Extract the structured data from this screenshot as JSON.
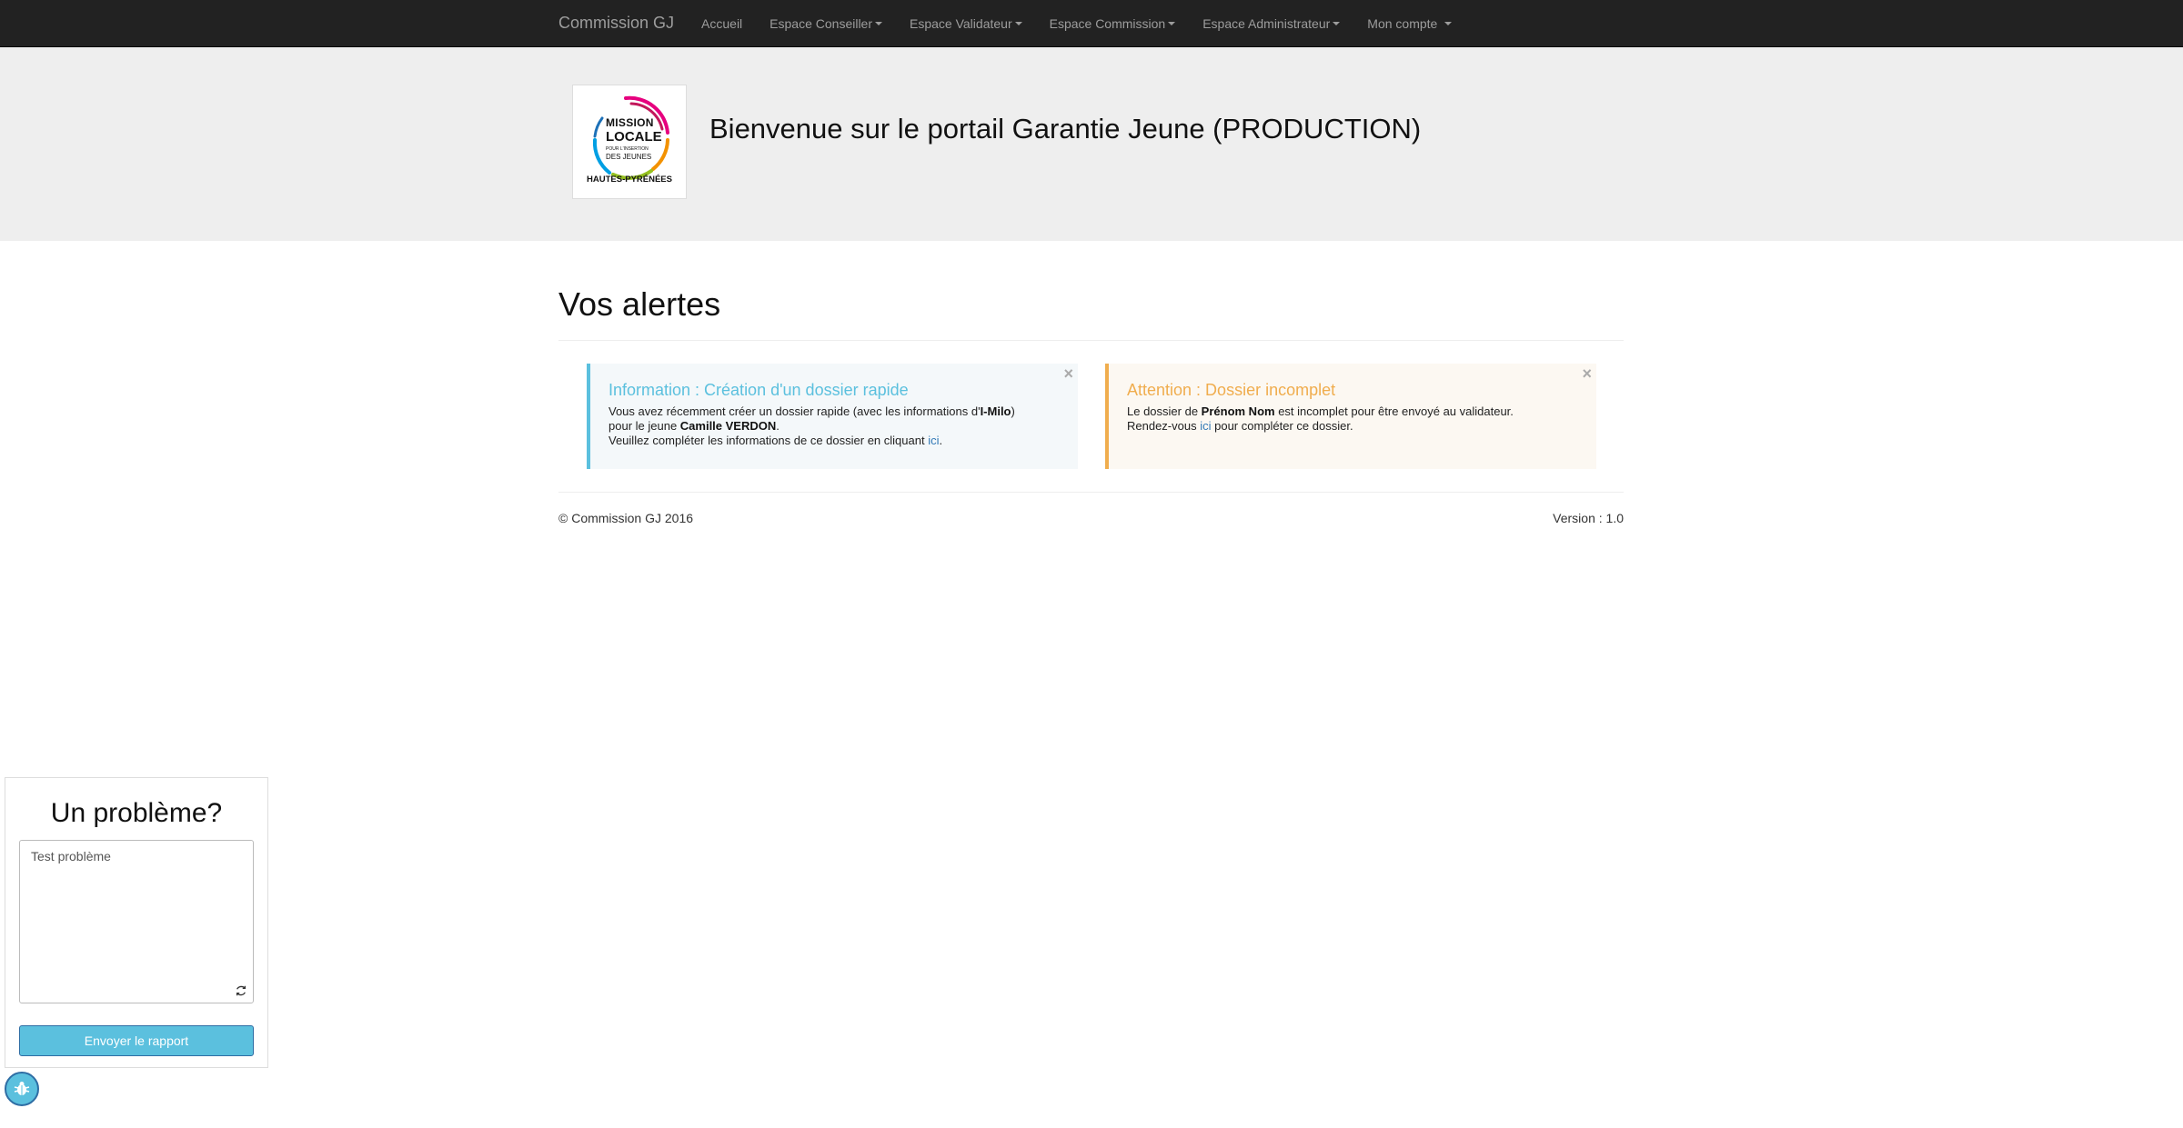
{
  "navbar": {
    "brand": "Commission GJ",
    "items": [
      {
        "label": "Accueil",
        "dropdown": false
      },
      {
        "label": "Espace Conseiller",
        "dropdown": true
      },
      {
        "label": "Espace Validateur",
        "dropdown": true
      },
      {
        "label": "Espace Commission",
        "dropdown": true
      },
      {
        "label": "Espace Administrateur",
        "dropdown": true
      },
      {
        "label": "Mon compte",
        "dropdown": true
      }
    ]
  },
  "jumbotron": {
    "logo": {
      "line1": "MISSION",
      "line2": "LOCALE",
      "line3": "POUR L'INSERTION",
      "line4": "DES JEUNES",
      "line5": "HAUTES-PYRÉNÉES"
    },
    "title": "Bienvenue sur le portail Garantie Jeune (PRODUCTION)"
  },
  "main": {
    "section_title": "Vos alertes",
    "alerts": [
      {
        "type": "info",
        "title": "Information : Création d'un dossier rapide",
        "line1_prefix": "Vous avez récemment créer un dossier rapide (avec les informations d'",
        "line1_bold": "I-Milo",
        "line1_suffix": ")",
        "line2_prefix": "pour le jeune ",
        "line2_bold": "Camille VERDON",
        "line2_suffix": ".",
        "line3_prefix": "Veuillez compléter les informations de ce dossier en cliquant ",
        "line3_link": "ici",
        "line3_suffix": ".",
        "close": "×"
      },
      {
        "type": "warning",
        "title": "Attention : Dossier incomplet",
        "line1_prefix": "Le dossier de ",
        "line1_bold": "Prénom Nom",
        "line1_suffix": " est incomplet pour être envoyé au validateur.",
        "line2_prefix": "Rendez-vous ",
        "line2_link": "ici",
        "line2_suffix": " pour compléter ce dossier.",
        "close": "×"
      }
    ]
  },
  "footer": {
    "copyright": "© Commission GJ 2016",
    "version": "Version : 1.0"
  },
  "feedback": {
    "title": "Un problème?",
    "textarea_value": "Test problème",
    "button_label": "Envoyer le rapport"
  },
  "colors": {
    "navbar_bg": "#222222",
    "jumbotron_bg": "#eeeeee",
    "info": "#5bc0de",
    "warning": "#f0ad4e",
    "link": "#337ab7"
  },
  "icons": [
    "caret-down-icon",
    "close-icon",
    "refresh-icon",
    "bug-icon",
    "mission-locale-logo"
  ]
}
